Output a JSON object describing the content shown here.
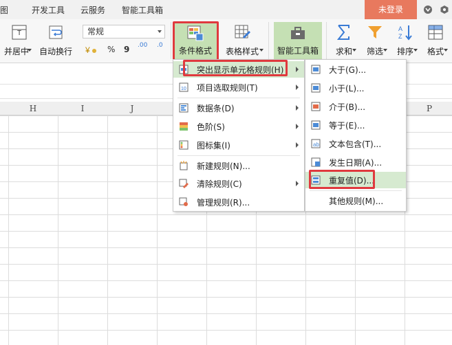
{
  "tabs": [
    "图",
    "开发工具",
    "云服务",
    "智能工具箱"
  ],
  "login_button": "未登录",
  "ribbon": {
    "merge_center": "并居中",
    "wrap_text": "自动换行",
    "number_format": "常规",
    "percent": "%",
    "comma": "9",
    "dec_inc": ".00",
    "dec_dec": ".0",
    "conditional_format": "条件格式",
    "table_style": "表格样式",
    "smart_toolbox": "智能工具箱",
    "sum": "求和",
    "filter": "筛选",
    "sort": "排序",
    "format": "格式"
  },
  "columns": [
    "H",
    "I",
    "J",
    "P"
  ],
  "cond_menu": [
    {
      "label": "突出显示单元格规则(H)",
      "submenu": true,
      "icon": "highlight-rules-icon"
    },
    {
      "label": "项目选取规则(T)",
      "submenu": true,
      "icon": "top-bottom-icon"
    },
    {
      "label": "数据条(D)",
      "submenu": true,
      "icon": "databar-icon"
    },
    {
      "label": "色阶(S)",
      "submenu": true,
      "icon": "colorscale-icon"
    },
    {
      "label": "图标集(I)",
      "submenu": true,
      "icon": "iconset-icon"
    },
    {
      "label": "新建规则(N)...",
      "submenu": false,
      "icon": "new-rule-icon"
    },
    {
      "label": "清除规则(C)",
      "submenu": true,
      "icon": "clear-rule-icon"
    },
    {
      "label": "管理规则(R)...",
      "submenu": false,
      "icon": "manage-rule-icon"
    }
  ],
  "sub_menu": [
    {
      "label": "大于(G)...",
      "icon": "greater-than-icon"
    },
    {
      "label": "小于(L)...",
      "icon": "less-than-icon"
    },
    {
      "label": "介于(B)...",
      "icon": "between-icon"
    },
    {
      "label": "等于(E)...",
      "icon": "equal-icon"
    },
    {
      "label": "文本包含(T)...",
      "icon": "text-contains-icon"
    },
    {
      "label": "发生日期(A)...",
      "icon": "date-occurring-icon"
    },
    {
      "label": "重复值(D)...",
      "icon": "duplicate-values-icon"
    },
    {
      "label": "其他规则(M)...",
      "icon": ""
    }
  ],
  "colors": {
    "accent_login": "#e8795e",
    "highlight_green": "#c5e0b4",
    "callout_red": "#e0393e",
    "menu_hover": "#d6ead0"
  }
}
